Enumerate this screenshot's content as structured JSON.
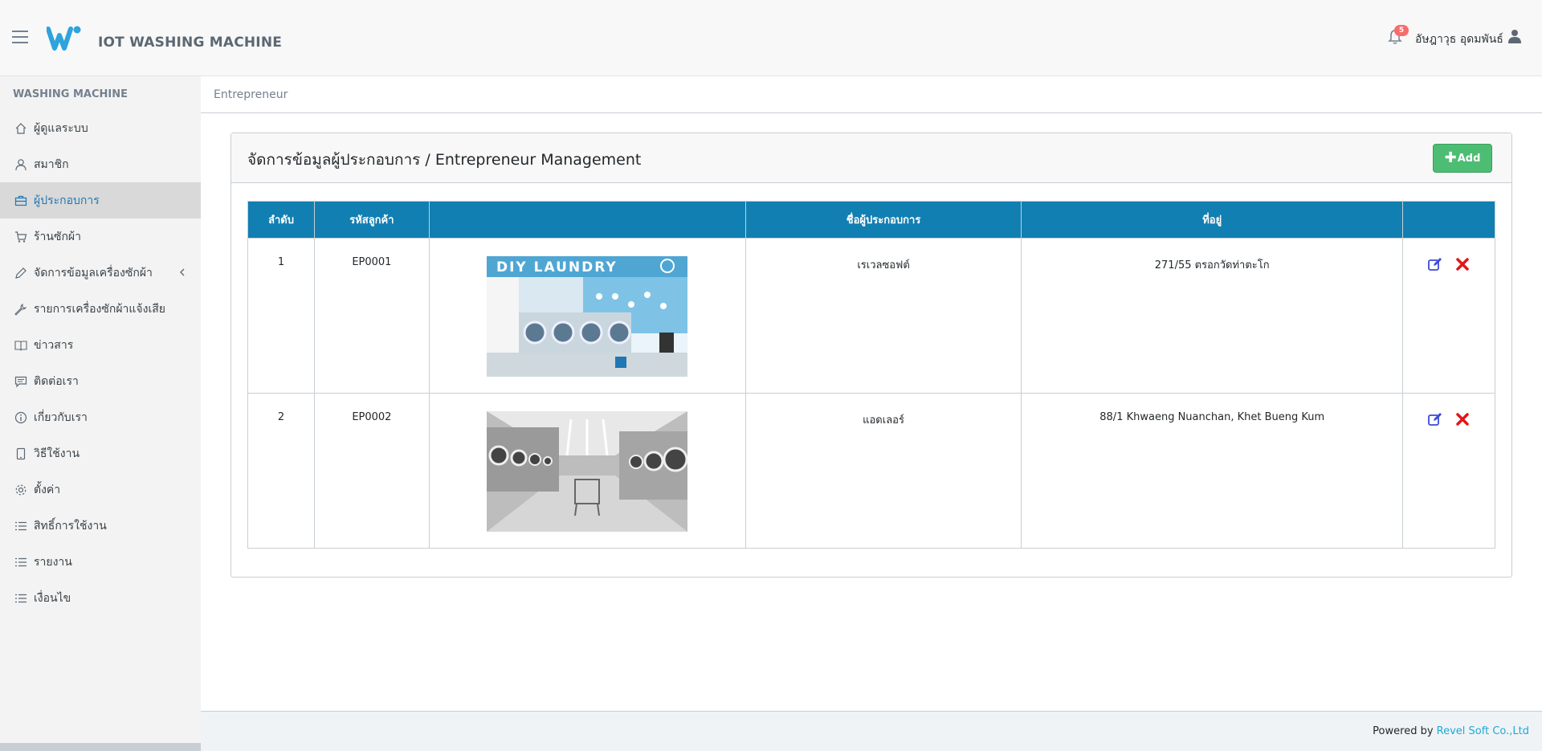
{
  "header": {
    "app_title": "IOT WASHING MACHINE",
    "notification_count": "5",
    "user_name": "อัษฎาวุธ อุดมพันธ์"
  },
  "sidebar": {
    "section_title": "WASHING MACHINE",
    "items": [
      {
        "label": "ผู้ดูแลระบบ",
        "icon": "home-icon"
      },
      {
        "label": "สมาชิก",
        "icon": "user-icon"
      },
      {
        "label": "ผู้ประกอบการ",
        "icon": "briefcase-icon",
        "active": true
      },
      {
        "label": "ร้านซักผ้า",
        "icon": "cart-icon"
      },
      {
        "label": "จัดการข้อมูลเครื่องซักผ้า",
        "icon": "pencil-icon",
        "has_children": true
      },
      {
        "label": "รายการเครื่องซักผ้าแจ้งเสีย",
        "icon": "wrench-icon"
      },
      {
        "label": "ข่าวสาร",
        "icon": "book-icon"
      },
      {
        "label": "ติดต่อเรา",
        "icon": "chat-icon"
      },
      {
        "label": "เกี่ยวกับเรา",
        "icon": "info-icon"
      },
      {
        "label": "วิธีใช้งาน",
        "icon": "phone-icon"
      },
      {
        "label": "ตั้งค่า",
        "icon": "gear-icon"
      },
      {
        "label": "สิทธิ์การใช้งาน",
        "icon": "list-icon"
      },
      {
        "label": "รายงาน",
        "icon": "list-icon"
      },
      {
        "label": "เงื่อนไข",
        "icon": "list-icon"
      }
    ]
  },
  "breadcrumb": {
    "current": "Entrepreneur"
  },
  "card": {
    "title": "จัดการข้อมูลผู้ประกอบการ / Entrepreneur Management",
    "add_label": "Add"
  },
  "table": {
    "columns": [
      "ลำดับ",
      "รหัสลูกค้า",
      "",
      "ชื่อผู้ประกอบการ",
      "ที่อยู่",
      ""
    ],
    "rows": [
      {
        "no": "1",
        "code": "EP0001",
        "image_text": "DIY LAUNDRY",
        "name": "เรเวลซอฟต์",
        "address": "271/55 ตรอกวัดท่าตะโก"
      },
      {
        "no": "2",
        "code": "EP0002",
        "image_text": "",
        "name": "แอดเลอร์",
        "address": "88/1 Khwaeng Nuanchan, Khet Bueng Kum"
      }
    ]
  },
  "footer": {
    "powered_by": "Powered by",
    "company": "Revel Soft Co.,Ltd"
  },
  "colors": {
    "accent": "#20a8d8",
    "table_header": "#117fb1",
    "add_button": "#4dbd74",
    "delete": "#e3151a",
    "edit": "#3a4ad8"
  }
}
